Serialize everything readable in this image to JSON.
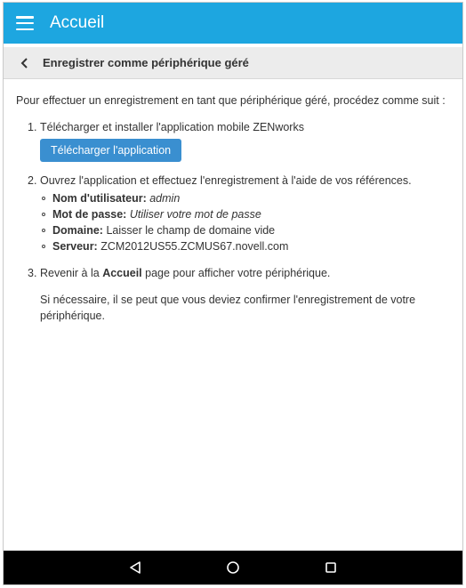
{
  "appbar": {
    "title": "Accueil",
    "menu_icon": "hamburger-menu-icon"
  },
  "subheader": {
    "title": "Enregistrer comme périphérique géré",
    "back_icon": "chevron-left-icon"
  },
  "content": {
    "intro": "Pour effectuer un enregistrement en tant que périphérique géré, procédez comme suit :",
    "step1": {
      "number": "1.",
      "text": "Télécharger et installer l'application mobile ZENworks",
      "button_label": "Télécharger l'application"
    },
    "step2": {
      "number": "2.",
      "text": "Ouvrez l'application et effectuez l'enregistrement à l'aide de vos références.",
      "credentials": [
        {
          "label": "Nom d'utilisateur:",
          "value": "admin"
        },
        {
          "label": "Mot de passe:",
          "value": "Utiliser votre mot de passe"
        },
        {
          "label": "Domaine:",
          "value": "Laisser le champ de domaine vide"
        },
        {
          "label": "Serveur:",
          "value": "ZCM2012US55.ZCMUS67.novell.com"
        }
      ]
    },
    "step3": {
      "number": "3.",
      "prefix": "Revenir à la ",
      "bold": "Accueil",
      "suffix": " page pour afficher votre périphérique.",
      "note": "Si nécessaire, il se peut que vous deviez confirmer l'enregistrement de votre périphérique."
    }
  },
  "navbar": {
    "back_icon": "nav-back-triangle-icon",
    "home_icon": "nav-home-circle-icon",
    "recents_icon": "nav-recents-square-icon"
  },
  "colors": {
    "appbar": "#1da6e0",
    "button": "#3a8fd0",
    "subheader": "#ececec",
    "navbar": "#000000"
  }
}
